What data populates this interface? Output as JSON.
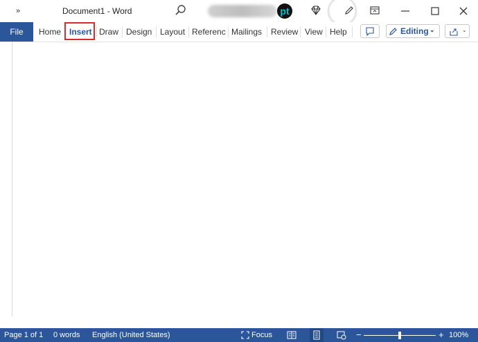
{
  "titlebar": {
    "doc_title": "Document1  -  Word",
    "qa_expand": "»",
    "logo_text": "pt"
  },
  "ribbon": {
    "tabs": [
      {
        "label": "File"
      },
      {
        "label": "Home"
      },
      {
        "label": "Insert"
      },
      {
        "label": "Draw"
      },
      {
        "label": "Design"
      },
      {
        "label": "Layout"
      },
      {
        "label": "Referenc"
      },
      {
        "label": "Mailings"
      },
      {
        "label": "Review"
      },
      {
        "label": "View"
      },
      {
        "label": "Help"
      }
    ],
    "editing_label": "Editing",
    "highlighted_tab": "Insert"
  },
  "statusbar": {
    "page": "Page 1 of 1",
    "words": "0 words",
    "language": "English (United States)",
    "focus": "Focus",
    "zoom_minus": "−",
    "zoom_plus": "+",
    "zoom": "100%"
  },
  "colors": {
    "brand": "#2b579a",
    "highlight": "#d92b2b"
  }
}
